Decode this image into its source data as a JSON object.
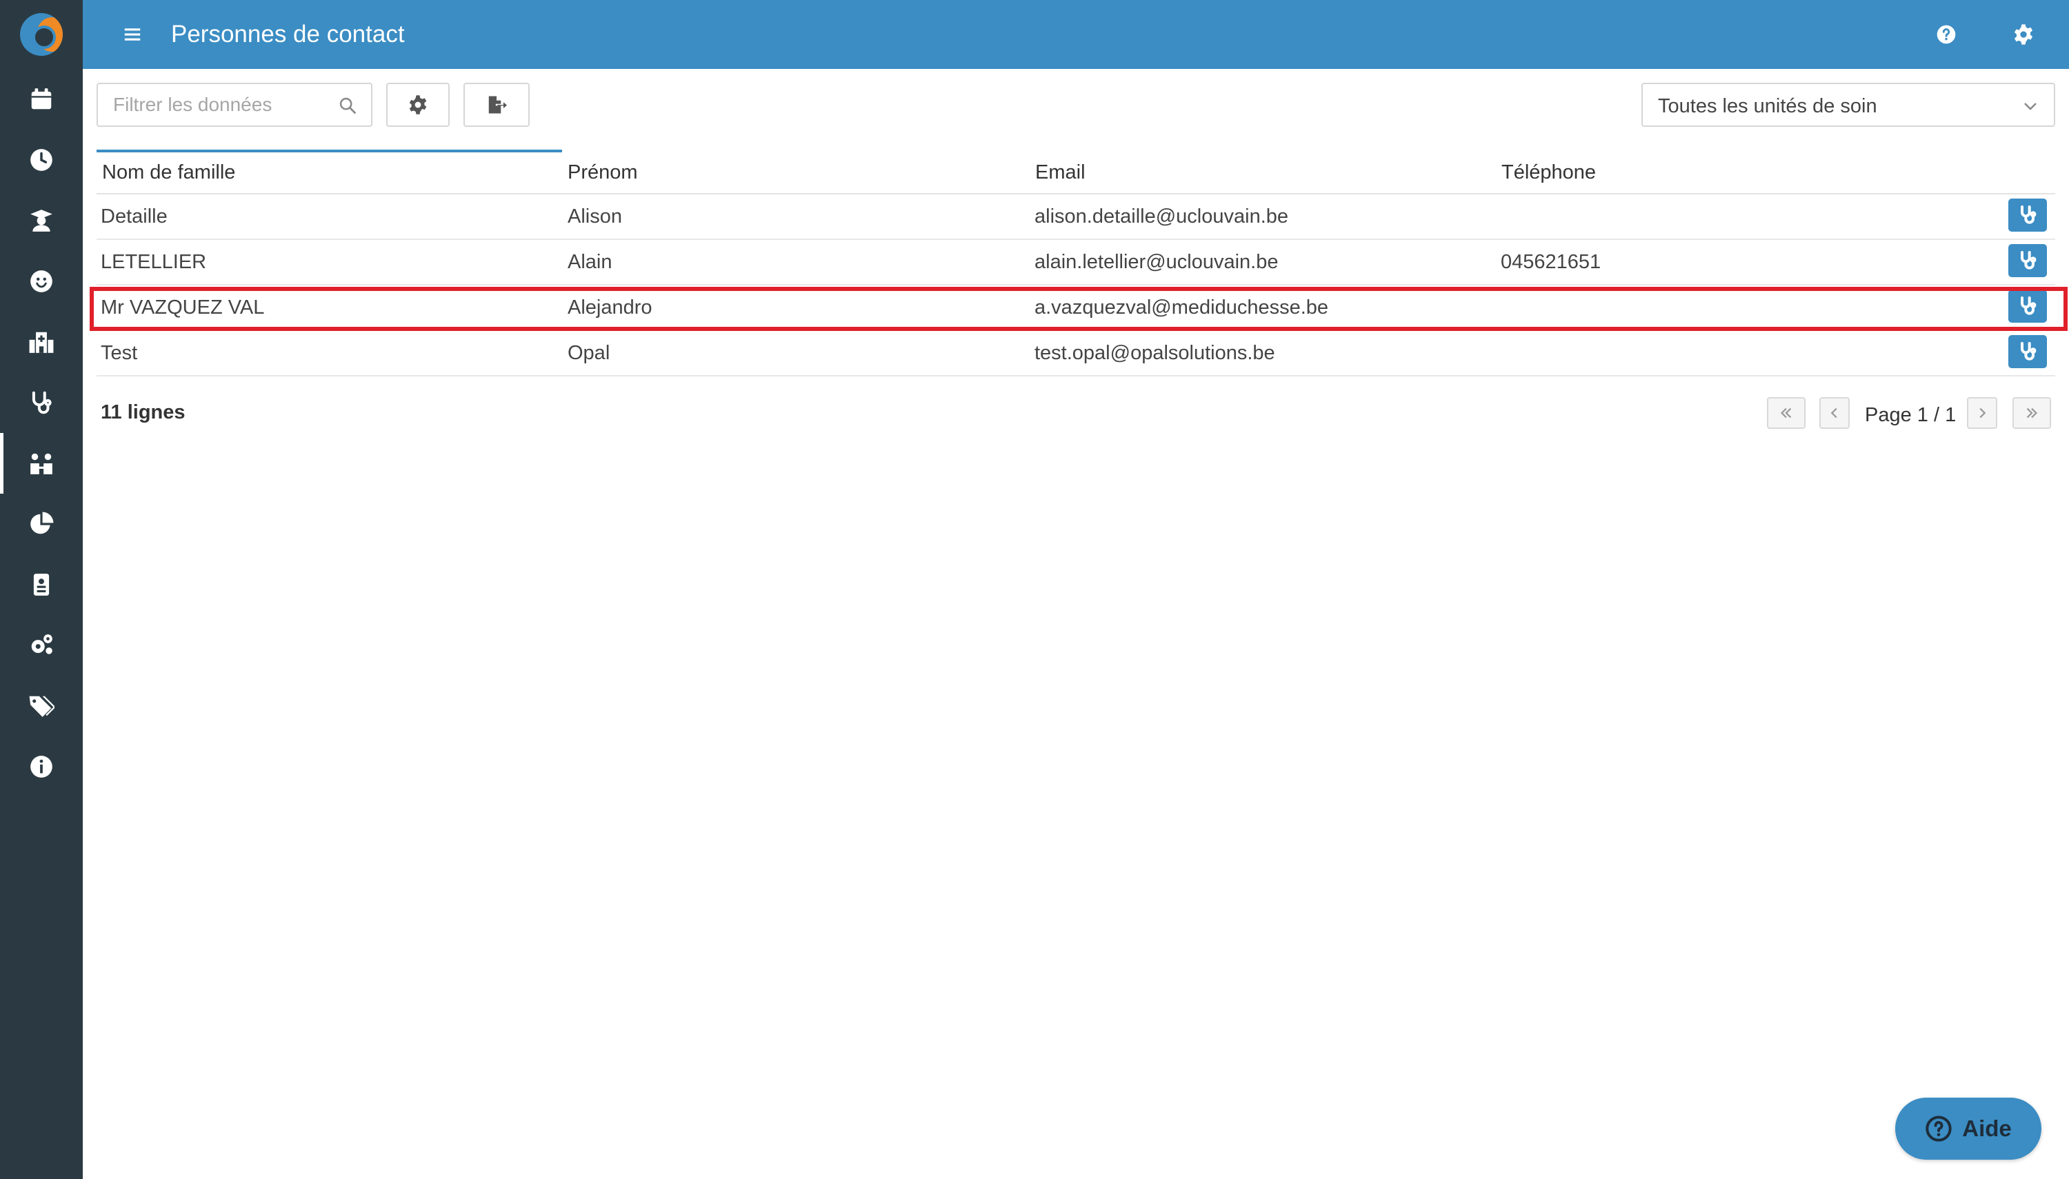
{
  "header": {
    "title": "Personnes de contact"
  },
  "sidebar": {
    "items": [
      {
        "name": "calendar-icon",
        "active": false
      },
      {
        "name": "clock-icon",
        "active": false
      },
      {
        "name": "graduate-icon",
        "active": false
      },
      {
        "name": "smiley-icon",
        "active": false
      },
      {
        "name": "hospital-icon",
        "active": false
      },
      {
        "name": "stethoscope-icon",
        "active": false
      },
      {
        "name": "contacts-icon",
        "active": true
      },
      {
        "name": "pie-chart-icon",
        "active": false
      },
      {
        "name": "id-badge-icon",
        "active": false
      },
      {
        "name": "gears-icon",
        "active": false
      },
      {
        "name": "tags-icon",
        "active": false
      },
      {
        "name": "info-icon",
        "active": false
      }
    ]
  },
  "toolbar": {
    "search_placeholder": "Filtrer les données",
    "search_value": "",
    "care_unit_selected": "Toutes les unités de soin"
  },
  "table": {
    "columns": [
      "Nom de famille",
      "Prénom",
      "Email",
      "Téléphone"
    ],
    "sorted_column": "Nom de famille",
    "rows": [
      {
        "last_name": "Detaille",
        "first_name": "Alison",
        "email": "alison.detaille@uclouvain.be",
        "phone": ""
      },
      {
        "last_name": "LETELLIER",
        "first_name": "Alain",
        "email": "alain.letellier@uclouvain.be",
        "phone": "045621651"
      },
      {
        "last_name": "Mr VAZQUEZ VAL",
        "first_name": "Alejandro",
        "email": "a.vazquezval@mediduchesse.be",
        "phone": "",
        "highlighted": true
      },
      {
        "last_name": "Test",
        "first_name": "Opal",
        "email": "test.opal@opalsolutions.be",
        "phone": ""
      }
    ]
  },
  "footer": {
    "row_count": "11 lignes",
    "page_label": "Page 1 / 1"
  },
  "help_button": {
    "label": "Aide"
  },
  "colors": {
    "primary": "#3b8dc4",
    "sidebar": "#2b3a42",
    "highlight": "#e0202a",
    "logo_orange": "#f08a24"
  }
}
